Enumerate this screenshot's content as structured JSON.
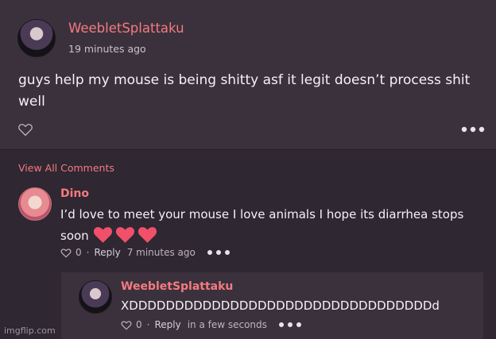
{
  "post": {
    "username": "WeebletSplattaku",
    "timestamp": "19 minutes ago",
    "body": "guys help my mouse is being shitty asf it legit doesn’t process shit well",
    "like_icon": "heart-outline-icon",
    "more_icon": "more-dots-icon"
  },
  "comments": {
    "view_all_label": "View All Comments",
    "items": [
      {
        "username": "Dino",
        "text": "I’d love to meet your mouse I love animals I hope its diarrhea stops soon",
        "emoji": "heart-emoji-x3",
        "like_count": "0",
        "separator": "·",
        "reply_label": "Reply",
        "timestamp": "7 minutes ago"
      }
    ],
    "reply": {
      "username": "WeebletSplattaku",
      "text": "XDDDDDDDDDDDDDDDDDDDDDDDDDDDDDDDDDd",
      "like_count": "0",
      "separator": "·",
      "reply_label": "Reply",
      "timestamp": "in a few seconds"
    }
  },
  "watermark": "imgflip.com",
  "colors": {
    "accent": "#f47a80",
    "post_bg": "#3a313c",
    "page_bg": "#2f2731",
    "heart_emoji": "#f0506a"
  }
}
